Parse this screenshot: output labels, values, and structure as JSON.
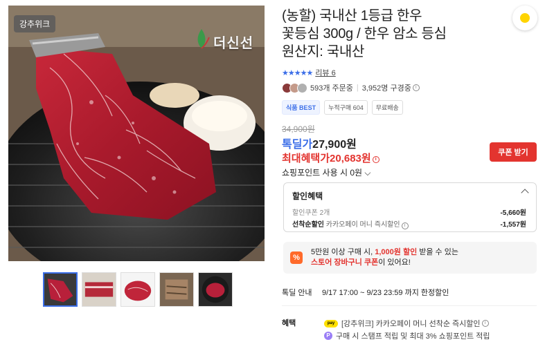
{
  "product_image": {
    "badge": "강추위크",
    "brand": "더신선"
  },
  "thumbnails": [
    {
      "name": "thumb-1",
      "active": true
    },
    {
      "name": "thumb-2",
      "active": false
    },
    {
      "name": "thumb-3",
      "active": false
    },
    {
      "name": "thumb-4",
      "active": false
    },
    {
      "name": "thumb-5",
      "active": false
    }
  ],
  "product": {
    "title_line1": "(농할) 국내산 1등급 한우",
    "title_line2": "꽃등심 300g / 한우 암소 등심",
    "title_line3": "원산지: 국내산",
    "stars": "★★★★★",
    "review_link": "리뷰 6",
    "orders": "593개 주문중",
    "subscribers": "3,952명 구경중",
    "tags": [
      "식품 BEST",
      "누적구매 604",
      "무료배송"
    ]
  },
  "pricing": {
    "original_price": "34,900원",
    "deal_label": "톡딜가",
    "deal_price": "27,900원",
    "max_benefit_label": "최대혜택가",
    "max_benefit_price": "20,683원",
    "coupon_button": "쿠폰 받기",
    "shopping_point": "쇼핑포인트 사용 시 0원"
  },
  "discount": {
    "header": "할인혜택",
    "rows": [
      {
        "label": "할인쿠폰 2개",
        "amount": "-5,660원"
      },
      {
        "label_bold": "선착순할인",
        "label": "카카오페이 머니 즉시할인",
        "amount": "-1,557원"
      }
    ]
  },
  "promo": {
    "line1_a": "5만원 이상 구매 시, ",
    "line1_hl": "1,000원 할인",
    "line1_b": " 받을 수 있는",
    "line2_hl": "스토어 장바구니 쿠폰",
    "line2_b": "이 있어요!"
  },
  "deal_info": {
    "label": "톡딜 안내",
    "value": "9/17 17:00 ~ 9/23 23:59 까지 한정할인"
  },
  "benefit": {
    "label": "혜택",
    "rows": [
      {
        "icon": "kakaopay-icon",
        "text": "[강추위크] 카카오페이 머니 선착순 즉시할인"
      },
      {
        "icon": "point-icon",
        "text": "구매 시 스탬프 적립 및 최대 3% 쇼핑포인트 적립"
      }
    ]
  },
  "colors": {
    "accent_blue": "#3b6ee8",
    "accent_red": "#e3342f",
    "promo_orange": "#ff6a2a"
  }
}
